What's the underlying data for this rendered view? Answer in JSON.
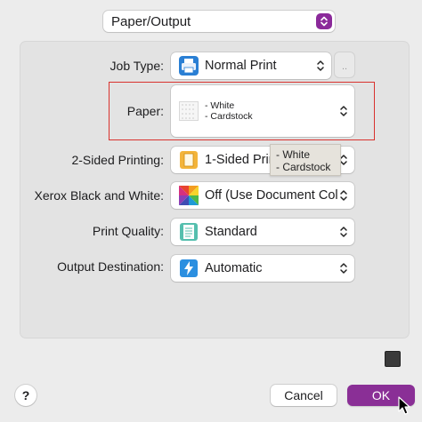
{
  "section": {
    "selected": "Paper/Output",
    "accent": "#8b2a9a"
  },
  "rows": [
    {
      "label": "Job Type:",
      "value": "Normal Print",
      "icon": "printer-icon"
    },
    {
      "label": "Paper:",
      "value_line1": "- White",
      "value_line2": "- Cardstock",
      "icon": "paper-icon"
    },
    {
      "label": "2-Sided Printing:",
      "value": "1-Sided Print",
      "icon": "one-sided-page-icon"
    },
    {
      "label": "Xerox Black and White:",
      "value": "Off (Use Document Color)",
      "icon": "color-grid-icon"
    },
    {
      "label": "Print Quality:",
      "value": "Standard",
      "icon": "document-lines-icon"
    },
    {
      "label": "Output Destination:",
      "value": "Automatic",
      "icon": "lightning-icon"
    }
  ],
  "ellipsis": "..",
  "tooltip": {
    "line1": "- White",
    "line2": "- Cardstock"
  },
  "footer": {
    "help": "?",
    "cancel": "Cancel",
    "ok": "OK",
    "ok_color": "#8a2f96"
  },
  "highlight_color": "#d9322e"
}
